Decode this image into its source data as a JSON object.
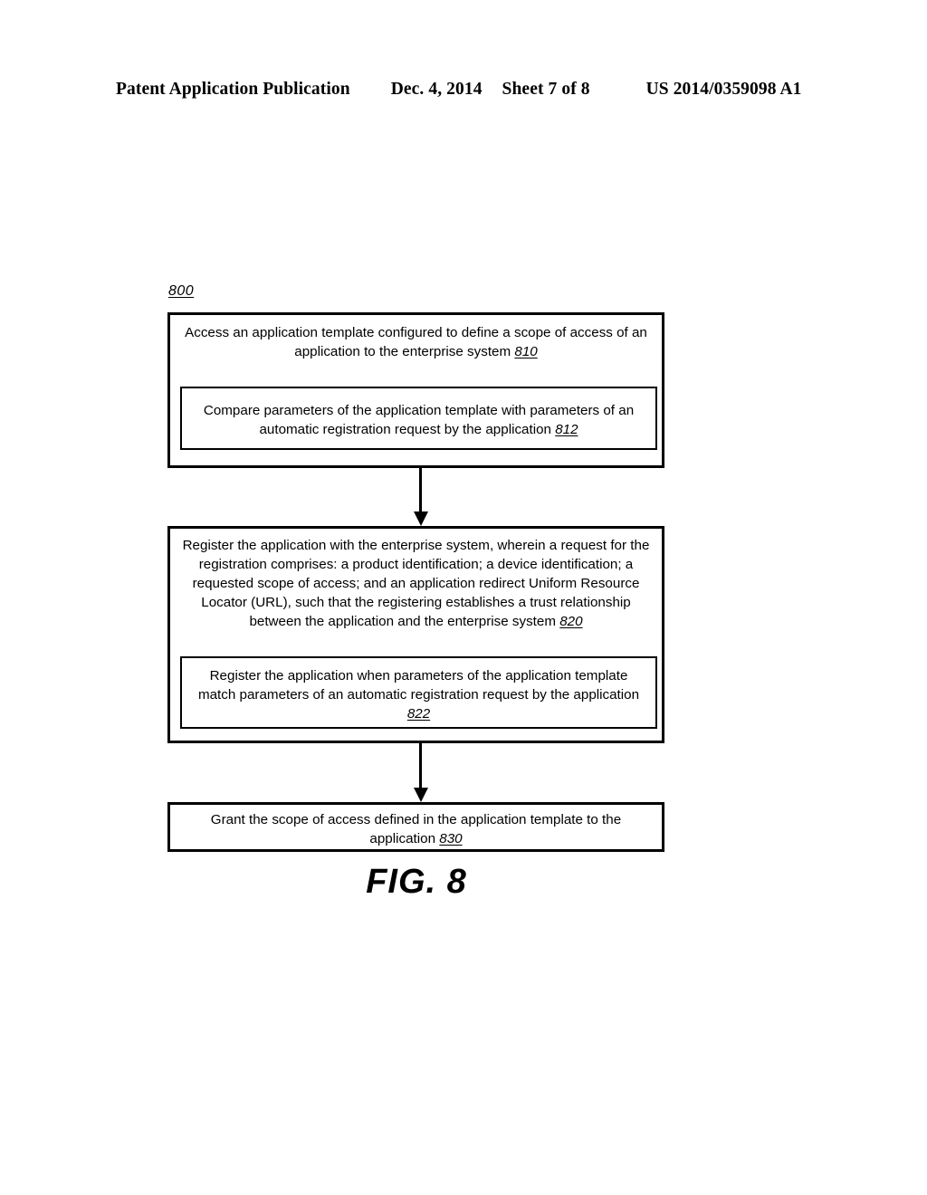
{
  "header": {
    "publication": "Patent Application Publication",
    "date": "Dec. 4, 2014",
    "sheet": "Sheet 7 of 8",
    "document_number": "US 2014/0359098 A1"
  },
  "figure": {
    "reference_numeral": "800",
    "caption": "FIG. 8",
    "boxes": {
      "b810": {
        "text": "Access an application template configured to define a scope of access of an application to the enterprise system ",
        "ref": "810"
      },
      "b812": {
        "text": "Compare parameters of the application template with parameters of an automatic registration request by the application ",
        "ref": "812"
      },
      "b820": {
        "text": "Register the application with the enterprise system, wherein a request for the registration comprises: a product identification; a device identification; a requested scope of access; and an application redirect Uniform Resource Locator (URL), such that the registering establishes a trust relationship between the application and the enterprise system ",
        "ref": "820"
      },
      "b822": {
        "text": "Register the application when parameters of the application template match parameters of an automatic registration request by the application ",
        "ref": "822"
      },
      "b830": {
        "text": "Grant the scope of access defined in the application template to the application ",
        "ref": "830"
      }
    }
  }
}
